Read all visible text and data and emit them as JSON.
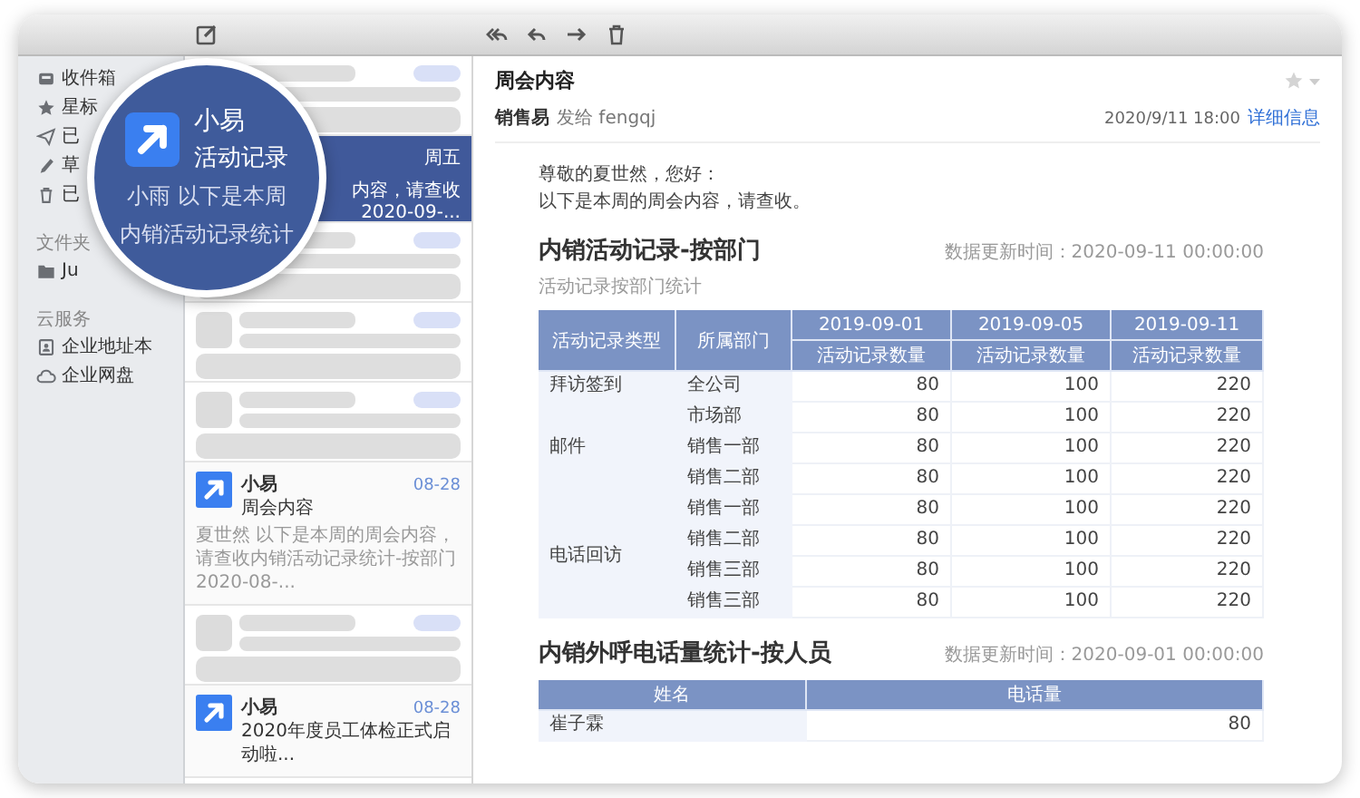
{
  "sidebar": {
    "items": [
      {
        "kind": "inbox",
        "label": "收件箱"
      },
      {
        "kind": "star",
        "label": "星标"
      },
      {
        "kind": "send",
        "label": "已"
      },
      {
        "kind": "draft",
        "label": "草"
      },
      {
        "kind": "trash",
        "label": "已"
      }
    ],
    "groups": [
      {
        "title": "文件夹",
        "items": [
          {
            "kind": "folder",
            "label": "Ju"
          }
        ]
      },
      {
        "title": "云服务",
        "items": [
          {
            "kind": "contacts",
            "label": "企业地址本"
          },
          {
            "kind": "cloud",
            "label": "企业网盘"
          }
        ]
      }
    ]
  },
  "magnifier": {
    "sender": "小易",
    "subject": "活动记录",
    "lines": [
      "小雨 以下是本周",
      "内销活动记录统计"
    ]
  },
  "mail_list": [
    {
      "kind": "placeholder"
    },
    {
      "kind": "mail",
      "selected": true,
      "date": "周五",
      "preview_lines": [
        "内容，请查收",
        "2020-09-..."
      ]
    },
    {
      "kind": "placeholder"
    },
    {
      "kind": "placeholder"
    },
    {
      "kind": "placeholder"
    },
    {
      "kind": "mail",
      "selected": false,
      "sender": "小易",
      "date": "08-28",
      "subject": "周会内容",
      "preview": "夏世然 以下是本周的周会内容，请查收内销活动记录统计-按部门 2020-08-..."
    },
    {
      "kind": "placeholder"
    },
    {
      "kind": "mail",
      "selected": false,
      "sender": "小易",
      "date": "08-28",
      "subject": "2020年度员工体检正式启动啦..."
    }
  ],
  "message": {
    "title": "周会内容",
    "starred": false,
    "sender": "销售易",
    "recipient": "发给 fengqj",
    "time": "2020/9/11 18:00",
    "details_link": "详细信息",
    "greeting": [
      "尊敬的夏世然，您好：",
      "以下是本周的周会内容，请查收。"
    ],
    "sections": [
      {
        "kind": "grouped",
        "title": "内销活动记录-按部门",
        "updated": "数据更新时间：2020-09-11 00:00:00",
        "subtitle": "活动记录按部门统计",
        "header_top": [
          "活动记录类型",
          "所属部门",
          "2019-09-01",
          "2019-09-05",
          "2019-09-11"
        ],
        "header_sub": [
          "活动记录数量",
          "活动记录数量",
          "活动记录数量"
        ],
        "groups": [
          {
            "type": "拜访签到",
            "rows": [
              {
                "dept": "全公司",
                "values": [
                  "80",
                  "100",
                  "220"
                ]
              }
            ]
          },
          {
            "type": "邮件",
            "rows": [
              {
                "dept": "市场部",
                "values": [
                  "80",
                  "100",
                  "220"
                ]
              },
              {
                "dept": "销售一部",
                "values": [
                  "80",
                  "100",
                  "220"
                ]
              },
              {
                "dept": "销售二部",
                "values": [
                  "80",
                  "100",
                  "220"
                ]
              }
            ]
          },
          {
            "type": "电话回访",
            "rows": [
              {
                "dept": "销售一部",
                "values": [
                  "80",
                  "100",
                  "220"
                ]
              },
              {
                "dept": "销售二部",
                "values": [
                  "80",
                  "100",
                  "220"
                ]
              },
              {
                "dept": "销售三部",
                "values": [
                  "80",
                  "100",
                  "220"
                ]
              },
              {
                "dept": "销售三部",
                "values": [
                  "80",
                  "100",
                  "220"
                ]
              }
            ]
          }
        ]
      },
      {
        "kind": "simple",
        "title": "内销外呼电话量统计-按人员",
        "updated": "数据更新时间：2020-09-01 00:00:00",
        "columns": [
          "姓名",
          "电话量"
        ],
        "rows": [
          [
            "崔子霖",
            "80"
          ]
        ]
      }
    ]
  }
}
